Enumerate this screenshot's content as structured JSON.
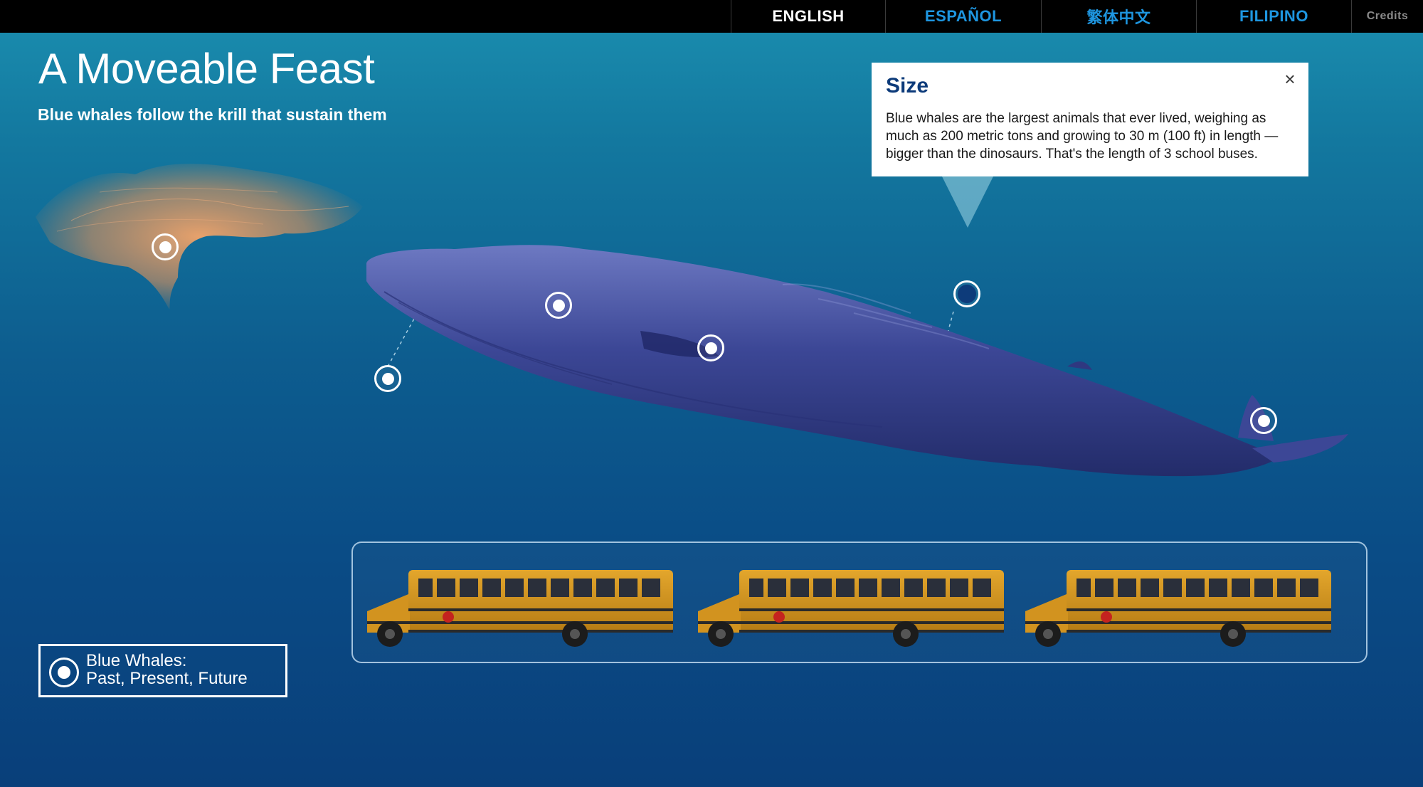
{
  "nav": {
    "languages": [
      {
        "label": "ENGLISH",
        "active": true
      },
      {
        "label": "ESPAÑOL",
        "active": false
      },
      {
        "label": "繁体中文",
        "active": false
      },
      {
        "label": "FILIPINO",
        "active": false
      }
    ],
    "credits_label": "Credits"
  },
  "header": {
    "title": "A Moveable Feast",
    "subtitle": "Blue whales follow the krill that sustain them"
  },
  "popup": {
    "title": "Size",
    "body": "Blue whales are the largest animals that ever lived, weighing as much as 200 metric tons and growing to 30 m (100 ft) in length — bigger than the dinosaurs. That's the length of 3 school buses.",
    "close_icon": "close-icon"
  },
  "legend": {
    "line1": "Blue Whales:",
    "line2": "Past, Present, Future"
  },
  "buses": {
    "count": 3
  },
  "colors": {
    "nav_inactive": "#1e96e0",
    "popup_title": "#0d3b7a",
    "background_top": "#1b8fb0",
    "background_bottom": "#093f7a"
  }
}
